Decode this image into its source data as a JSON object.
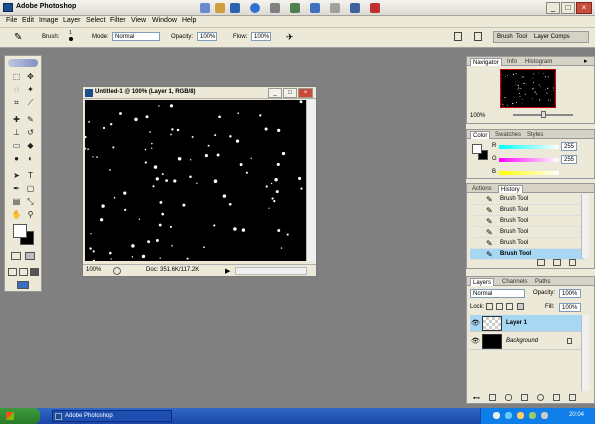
{
  "window": {
    "title": "Adobe Photoshop"
  },
  "menu": [
    "File",
    "Edit",
    "Image",
    "Layer",
    "Select",
    "Filter",
    "View",
    "Window",
    "Help"
  ],
  "options": {
    "brush_label": "Brush:",
    "brush_size": "1",
    "mode_label": "Mode:",
    "mode_value": "Normal",
    "opacity_label": "Opacity:",
    "opacity_value": "100%",
    "flow_label": "Flow:",
    "flow_value": "100%",
    "well_tabs": [
      "Brush",
      "Tool",
      "Layer Comps"
    ]
  },
  "document": {
    "title": "Untitled-1 @ 100% (Layer 1, RGB/8)",
    "zoom": "100%",
    "doc_size": "Doc: 351.6K/117.2K"
  },
  "navigator": {
    "tabs": [
      "Navigator",
      "Info",
      "Histogram"
    ],
    "zoom": "100%"
  },
  "color": {
    "tabs": [
      "Color",
      "Swatches",
      "Styles"
    ],
    "r_label": "R",
    "r_value": "255",
    "g_label": "G",
    "g_value": "255",
    "b_label": "B",
    "b_value": "255"
  },
  "history": {
    "tabs": [
      "Actions",
      "History"
    ],
    "items": [
      "Brush Tool",
      "Brush Tool",
      "Brush Tool",
      "Brush Tool",
      "Brush Tool",
      "Brush Tool"
    ],
    "selected_index": 5
  },
  "layers": {
    "tabs": [
      "Layers",
      "Channels",
      "Paths"
    ],
    "blend_mode": "Normal",
    "opacity_label": "Opacity:",
    "opacity_value": "100%",
    "lock_label": "Lock:",
    "fill_label": "Fill:",
    "fill_value": "100%",
    "items": [
      {
        "name": "Layer 1",
        "selected": true
      },
      {
        "name": "Background",
        "selected": false
      }
    ]
  },
  "taskbar": {
    "app_label": "Adobe Photoshop",
    "time": "20:04"
  },
  "colors": {
    "selection": "#a8d7f3",
    "taskbar": "#2255bb",
    "canvas": "#000000"
  }
}
